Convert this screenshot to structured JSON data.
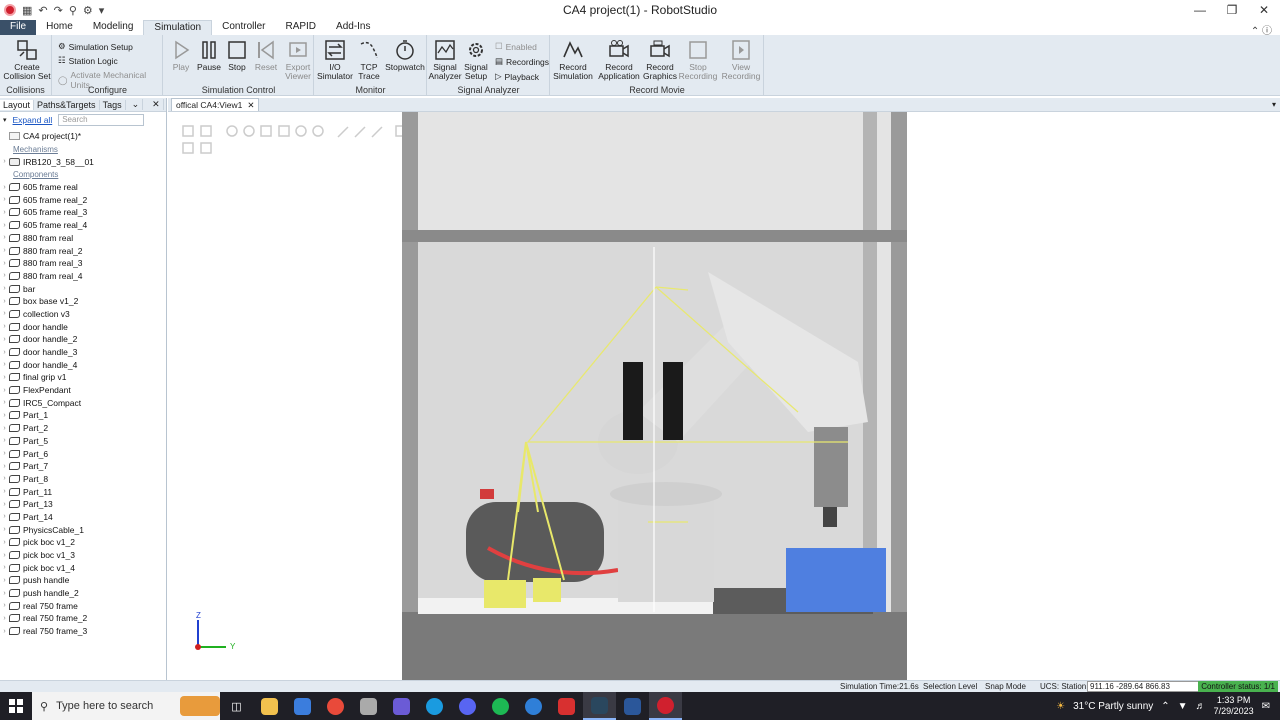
{
  "window": {
    "title": "CA4 project(1) - RobotStudio"
  },
  "menu": {
    "tabs": [
      "File",
      "Home",
      "Modeling",
      "Simulation",
      "Controller",
      "RAPID",
      "Add-Ins"
    ],
    "active": "Simulation"
  },
  "ribbon": {
    "collisions": {
      "label": "Collisions",
      "create": "Create\nCollision Set"
    },
    "configure": {
      "label": "Configure",
      "setup": "Simulation Setup",
      "logic": "Station Logic",
      "activate": "Activate Mechanical Units"
    },
    "sim_control": {
      "label": "Simulation Control",
      "play": "Play",
      "pause": "Pause",
      "stop": "Stop",
      "reset": "Reset"
    },
    "monitor": {
      "label": "Monitor",
      "export": "Export\nViewer",
      "io": "I/O\nSimulator",
      "tcp": "TCP\nTrace",
      "stopwatch": "Stopwatch"
    },
    "signal": {
      "label": "Signal Analyzer",
      "analyzer": "Signal\nAnalyzer",
      "setup": "Signal\nSetup",
      "enabled": "Enabled",
      "recordings": "Recordings",
      "playback": "Playback"
    },
    "record": {
      "label": "Record Movie",
      "sim": "Record\nSimulation",
      "app": "Record\nApplication",
      "graphics": "Record\nGraphics",
      "stop": "Stop\nRecording",
      "view": "View\nRecording"
    }
  },
  "panel": {
    "tabs": [
      "Layout",
      "Paths&Targets",
      "Tags"
    ],
    "expand_all": "Expand all",
    "search_placeholder": "Search",
    "root": "CA4 project(1)*",
    "mechanisms_label": "Mechanisms",
    "mechanisms": [
      "IRB120_3_58__01"
    ],
    "components_label": "Components",
    "components": [
      "605 frame real",
      "605 frame real_2",
      "605 frame real_3",
      "605 frame real_4",
      "880 fram real",
      "880 fram real_2",
      "880 fram real_3",
      "880 fram real_4",
      "bar",
      "box base v1_2",
      "collection v3",
      "door handle",
      "door handle_2",
      "door handle_3",
      "door handle_4",
      "final grip v1",
      "FlexPendant",
      "IRC5_Compact",
      "Part_1",
      "Part_2",
      "Part_5",
      "Part_6",
      "Part_7",
      "Part_8",
      "Part_11",
      "Part_13",
      "Part_14",
      "PhysicsCable_1",
      "pick boc v1_2",
      "pick boc v1_3",
      "pick boc v1_4",
      "push handle",
      "push handle_2",
      "real 750 frame",
      "real 750 frame_2",
      "real 750 frame_3"
    ]
  },
  "view": {
    "tab": "offical CA4:View1",
    "axes": {
      "z": "Z",
      "y": "Y"
    }
  },
  "status": {
    "sim_time": "Simulation Time:21.6s",
    "selection": "Selection Level",
    "snap": "Snap Mode",
    "ucs_label": "UCS: Station",
    "ucs_value": "911.16 -289.64 866.83",
    "controller": "Controller status: 1/1"
  },
  "taskbar": {
    "search": "Type here to search",
    "weather": "31°C  Partly sunny",
    "time": "1:33 PM",
    "date": "7/29/2023"
  },
  "colors": {
    "ribbon": "#e3eaf1",
    "file_tab": "#3a5068",
    "controller_ok": "#49b24f",
    "box_blue": "#4f7fe0",
    "gripper_yellow": "#e8e86a"
  }
}
